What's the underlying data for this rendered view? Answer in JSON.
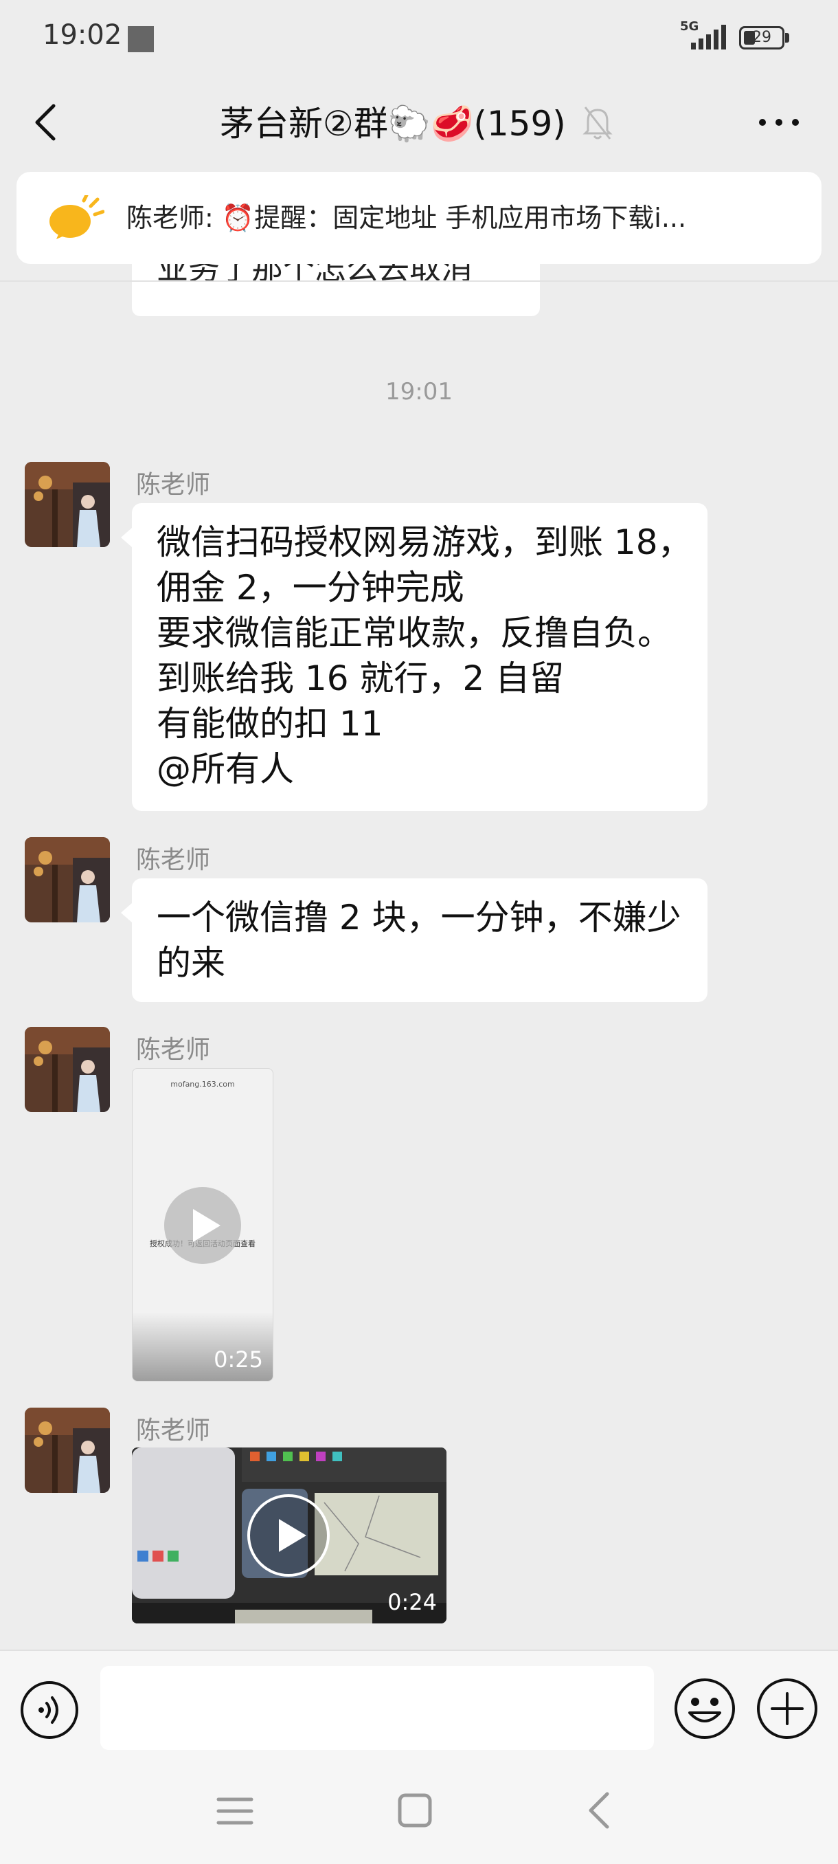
{
  "status_bar": {
    "time": "19:02",
    "network": "5G",
    "battery": "29",
    "battery_level": 0.29
  },
  "header": {
    "title": "茅台新②群🐑🥩(159)",
    "back_icon": "chevron-left-icon",
    "mute_icon": "bell-off-icon",
    "more_icon": "more-dots-icon"
  },
  "pinned": {
    "icon": "megaphone-icon",
    "text": "陈老师: ⏰提醒：固定地址 手机应用市场下载i..."
  },
  "partial_message": {
    "text": "业务了那个怎么去取消"
  },
  "timestamp": "19:01",
  "messages": [
    {
      "sender": "陈老师",
      "lines": [
        "微信扫码授权网易游戏，到账 18，",
        "佣金 2，一分钟完成",
        "要求微信能正常收款，反撸自负。",
        "到账给我 16 就行，2 自留",
        "有能做的扣 11",
        "@所有人"
      ]
    },
    {
      "sender": "陈老师",
      "lines": [
        "一个微信撸 2 块，一分钟，不嫌少",
        "的来"
      ]
    },
    {
      "sender": "陈老师",
      "video": {
        "duration": "0:25",
        "url_text": "mofang.163.com",
        "caption": "授权成功！可返回活动页面查看"
      }
    },
    {
      "sender": "陈老师",
      "video": {
        "duration": "0:24"
      }
    }
  ],
  "input_bar": {
    "placeholder": "",
    "voice_icon": "voice-icon",
    "emoji_icon": "emoji-icon",
    "plus_icon": "plus-icon"
  },
  "system_nav": {
    "menu_icon": "menu-icon",
    "home_icon": "home-icon",
    "back_icon": "back-triangle-icon"
  }
}
